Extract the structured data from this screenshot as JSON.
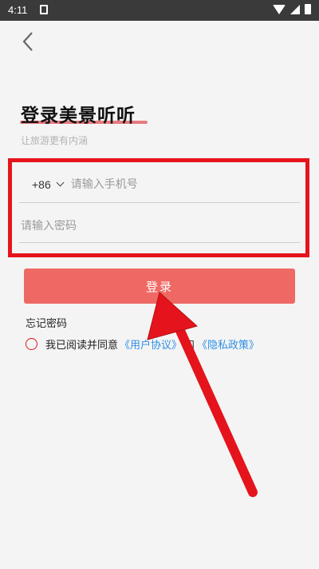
{
  "status_bar": {
    "time": "4:11"
  },
  "header": {
    "title": "登录美景听听",
    "subtitle": "让旅游更有内涵"
  },
  "form": {
    "country_code": "+86",
    "phone_placeholder": "请输入手机号",
    "password_placeholder": "请输入密码",
    "login_label": "登录",
    "forgot_label": "忘记密码"
  },
  "agreement": {
    "prefix": "我已阅读并同意",
    "user_agreement": "《用户协议》",
    "and": "和",
    "privacy_policy": "《隐私政策》"
  },
  "annotation_color": "#e5141c",
  "accent_color": "#ef6964",
  "link_color": "#2f8fe6"
}
